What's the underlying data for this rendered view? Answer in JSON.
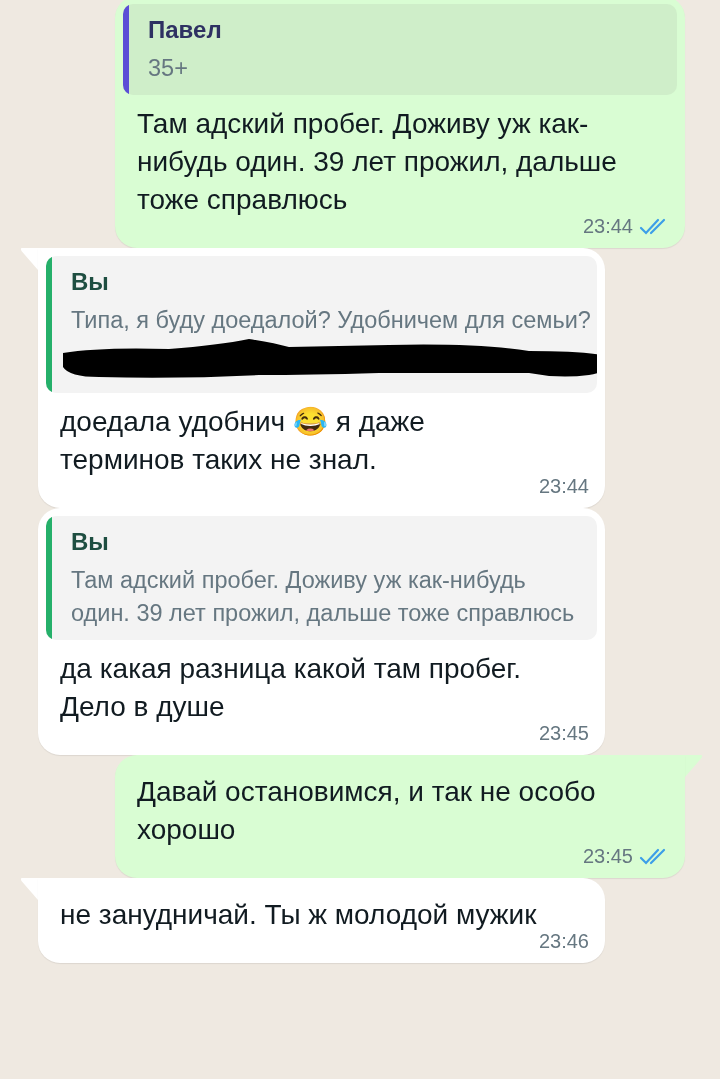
{
  "messages": [
    {
      "kind": "out",
      "tail": false,
      "quote": {
        "author": "Павел",
        "text": "35+",
        "color": "#5b4ed6"
      },
      "text": "Там адский пробег. Доживу уж как-нибудь один. 39 лет прожил, дальше тоже справлюсь",
      "time": "23:44",
      "read": true
    },
    {
      "kind": "in",
      "tail": true,
      "quote": {
        "author": "Вы",
        "text": "Типа, я буду доедалой? Удобничем для семьи?",
        "color": "#25b06a",
        "redacted": true
      },
      "text": "доедала удобнич 😂 я даже терминов таких не знал.",
      "time": "23:44"
    },
    {
      "kind": "in",
      "tail": false,
      "quote": {
        "author": "Вы",
        "text": "Там адский пробег. Доживу уж как-нибудь один. 39 лет прожил, дальше тоже справлюсь",
        "color": "#25b06a"
      },
      "text": "да какая разница какой там пробег. Дело в душе",
      "time": "23:45"
    },
    {
      "kind": "out",
      "tail": true,
      "text": "Давай остановимся, и так не особо хорошо",
      "time": "23:45",
      "read": true
    },
    {
      "kind": "in",
      "tail": true,
      "text": "не занудничай. Ты ж молодой мужик",
      "time": "23:46"
    }
  ]
}
